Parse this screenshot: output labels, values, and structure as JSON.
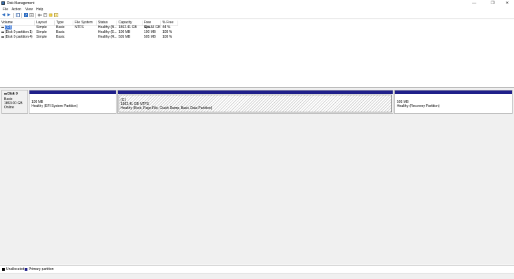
{
  "window": {
    "title": "Disk Management",
    "minimize_glyph": "—",
    "maximize_glyph": "❐",
    "close_glyph": "✕"
  },
  "menu": [
    "File",
    "Action",
    "View",
    "Help"
  ],
  "toolbar": {
    "icons": [
      "back-arrow-icon",
      "forward-arrow-icon",
      "console-tree-icon",
      "help-icon",
      "properties-icon",
      "connect-icon",
      "rescan-icon",
      "refresh-icon",
      "wizard-icon"
    ]
  },
  "volume_list": {
    "columns": [
      "Volume",
      "Layout",
      "Type",
      "File System",
      "Status",
      "Capacity",
      "Free Spa...",
      "% Free"
    ],
    "rows": [
      {
        "volume": "(C:)",
        "layout": "Simple",
        "type": "Basic",
        "fs": "NTFS",
        "status": "Healthy (B...",
        "capacity": "1862.41 GB",
        "free": "824.55 GB",
        "pct": "44 %"
      },
      {
        "volume": "(Disk 0 partition 1)",
        "layout": "Simple",
        "type": "Basic",
        "fs": "",
        "status": "Healthy (E...",
        "capacity": "100 MB",
        "free": "100 MB",
        "pct": "100 %"
      },
      {
        "volume": "(Disk 0 partition 4)",
        "layout": "Simple",
        "type": "Basic",
        "fs": "",
        "status": "Healthy (R...",
        "capacity": "505 MB",
        "free": "505 MB",
        "pct": "100 %"
      }
    ]
  },
  "disk": {
    "name": "Disk 0",
    "type": "Basic",
    "size": "1863.00 GB",
    "state": "Online",
    "partitions": [
      {
        "title": "",
        "size": "100 MB",
        "status": "Healthy (EFI System Partition)"
      },
      {
        "title": "(C:)",
        "size": "1862.41 GB NTFS",
        "status": "Healthy (Boot, Page File, Crash Dump, Basic Data Partition)"
      },
      {
        "title": "",
        "size": "505 MB",
        "status": "Healthy (Recovery Partition)"
      }
    ]
  },
  "legend": [
    {
      "label": "Unallocated",
      "color": "#000000"
    },
    {
      "label": "Primary partition",
      "color": "#1f1f8a"
    }
  ],
  "colors": {
    "partition_bar": "#1f1f8a",
    "selection": "#3c78d8"
  }
}
